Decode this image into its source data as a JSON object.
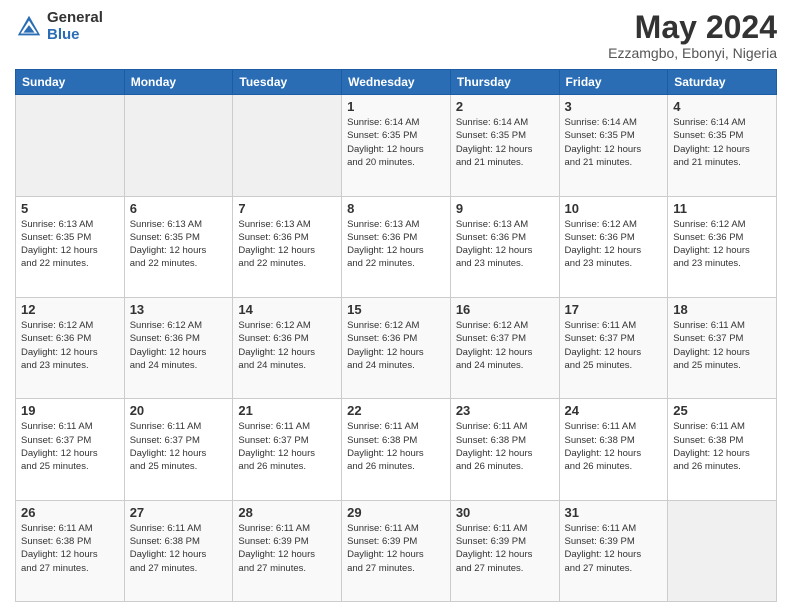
{
  "logo": {
    "general": "General",
    "blue": "Blue"
  },
  "title": "May 2024",
  "location": "Ezzamgbo, Ebonyi, Nigeria",
  "days_header": [
    "Sunday",
    "Monday",
    "Tuesday",
    "Wednesday",
    "Thursday",
    "Friday",
    "Saturday"
  ],
  "weeks": [
    [
      {
        "day": "",
        "info": ""
      },
      {
        "day": "",
        "info": ""
      },
      {
        "day": "",
        "info": ""
      },
      {
        "day": "1",
        "info": "Sunrise: 6:14 AM\nSunset: 6:35 PM\nDaylight: 12 hours\nand 20 minutes."
      },
      {
        "day": "2",
        "info": "Sunrise: 6:14 AM\nSunset: 6:35 PM\nDaylight: 12 hours\nand 21 minutes."
      },
      {
        "day": "3",
        "info": "Sunrise: 6:14 AM\nSunset: 6:35 PM\nDaylight: 12 hours\nand 21 minutes."
      },
      {
        "day": "4",
        "info": "Sunrise: 6:14 AM\nSunset: 6:35 PM\nDaylight: 12 hours\nand 21 minutes."
      }
    ],
    [
      {
        "day": "5",
        "info": "Sunrise: 6:13 AM\nSunset: 6:35 PM\nDaylight: 12 hours\nand 22 minutes."
      },
      {
        "day": "6",
        "info": "Sunrise: 6:13 AM\nSunset: 6:35 PM\nDaylight: 12 hours\nand 22 minutes."
      },
      {
        "day": "7",
        "info": "Sunrise: 6:13 AM\nSunset: 6:36 PM\nDaylight: 12 hours\nand 22 minutes."
      },
      {
        "day": "8",
        "info": "Sunrise: 6:13 AM\nSunset: 6:36 PM\nDaylight: 12 hours\nand 22 minutes."
      },
      {
        "day": "9",
        "info": "Sunrise: 6:13 AM\nSunset: 6:36 PM\nDaylight: 12 hours\nand 23 minutes."
      },
      {
        "day": "10",
        "info": "Sunrise: 6:12 AM\nSunset: 6:36 PM\nDaylight: 12 hours\nand 23 minutes."
      },
      {
        "day": "11",
        "info": "Sunrise: 6:12 AM\nSunset: 6:36 PM\nDaylight: 12 hours\nand 23 minutes."
      }
    ],
    [
      {
        "day": "12",
        "info": "Sunrise: 6:12 AM\nSunset: 6:36 PM\nDaylight: 12 hours\nand 23 minutes."
      },
      {
        "day": "13",
        "info": "Sunrise: 6:12 AM\nSunset: 6:36 PM\nDaylight: 12 hours\nand 24 minutes."
      },
      {
        "day": "14",
        "info": "Sunrise: 6:12 AM\nSunset: 6:36 PM\nDaylight: 12 hours\nand 24 minutes."
      },
      {
        "day": "15",
        "info": "Sunrise: 6:12 AM\nSunset: 6:36 PM\nDaylight: 12 hours\nand 24 minutes."
      },
      {
        "day": "16",
        "info": "Sunrise: 6:12 AM\nSunset: 6:37 PM\nDaylight: 12 hours\nand 24 minutes."
      },
      {
        "day": "17",
        "info": "Sunrise: 6:11 AM\nSunset: 6:37 PM\nDaylight: 12 hours\nand 25 minutes."
      },
      {
        "day": "18",
        "info": "Sunrise: 6:11 AM\nSunset: 6:37 PM\nDaylight: 12 hours\nand 25 minutes."
      }
    ],
    [
      {
        "day": "19",
        "info": "Sunrise: 6:11 AM\nSunset: 6:37 PM\nDaylight: 12 hours\nand 25 minutes."
      },
      {
        "day": "20",
        "info": "Sunrise: 6:11 AM\nSunset: 6:37 PM\nDaylight: 12 hours\nand 25 minutes."
      },
      {
        "day": "21",
        "info": "Sunrise: 6:11 AM\nSunset: 6:37 PM\nDaylight: 12 hours\nand 26 minutes."
      },
      {
        "day": "22",
        "info": "Sunrise: 6:11 AM\nSunset: 6:38 PM\nDaylight: 12 hours\nand 26 minutes."
      },
      {
        "day": "23",
        "info": "Sunrise: 6:11 AM\nSunset: 6:38 PM\nDaylight: 12 hours\nand 26 minutes."
      },
      {
        "day": "24",
        "info": "Sunrise: 6:11 AM\nSunset: 6:38 PM\nDaylight: 12 hours\nand 26 minutes."
      },
      {
        "day": "25",
        "info": "Sunrise: 6:11 AM\nSunset: 6:38 PM\nDaylight: 12 hours\nand 26 minutes."
      }
    ],
    [
      {
        "day": "26",
        "info": "Sunrise: 6:11 AM\nSunset: 6:38 PM\nDaylight: 12 hours\nand 27 minutes."
      },
      {
        "day": "27",
        "info": "Sunrise: 6:11 AM\nSunset: 6:38 PM\nDaylight: 12 hours\nand 27 minutes."
      },
      {
        "day": "28",
        "info": "Sunrise: 6:11 AM\nSunset: 6:39 PM\nDaylight: 12 hours\nand 27 minutes."
      },
      {
        "day": "29",
        "info": "Sunrise: 6:11 AM\nSunset: 6:39 PM\nDaylight: 12 hours\nand 27 minutes."
      },
      {
        "day": "30",
        "info": "Sunrise: 6:11 AM\nSunset: 6:39 PM\nDaylight: 12 hours\nand 27 minutes."
      },
      {
        "day": "31",
        "info": "Sunrise: 6:11 AM\nSunset: 6:39 PM\nDaylight: 12 hours\nand 27 minutes."
      },
      {
        "day": "",
        "info": ""
      }
    ]
  ]
}
